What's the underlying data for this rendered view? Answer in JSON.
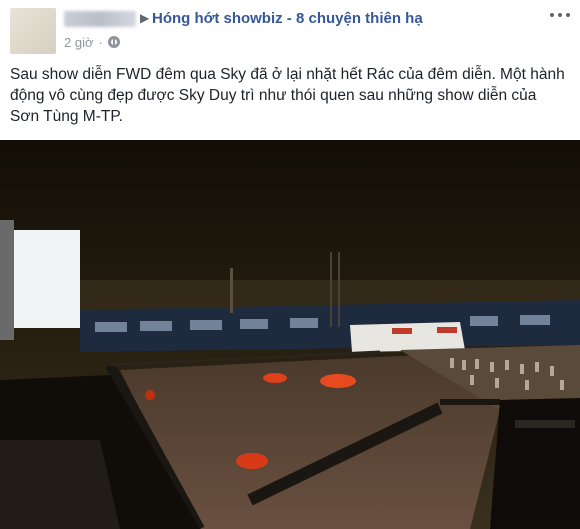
{
  "post": {
    "group_name": "Hóng hớt showbiz - 8 chuyện thiên hạ",
    "timestamp": "2 giờ",
    "body_text": "Sau show diễn FWD đêm qua Sky đã ở lại nhặt hết Rác của đêm diễn. Một hành động vô cùng đẹp được Sky Duy trì như thói quen sau những show diễn của Sơn Tùng M-TP.",
    "icons": {
      "menu": "more-options-icon",
      "privacy": "globe-icon",
      "arrow": "arrow-right-icon"
    }
  },
  "colors": {
    "link": "#365899",
    "text": "#1d2129",
    "meta": "#90949c"
  }
}
